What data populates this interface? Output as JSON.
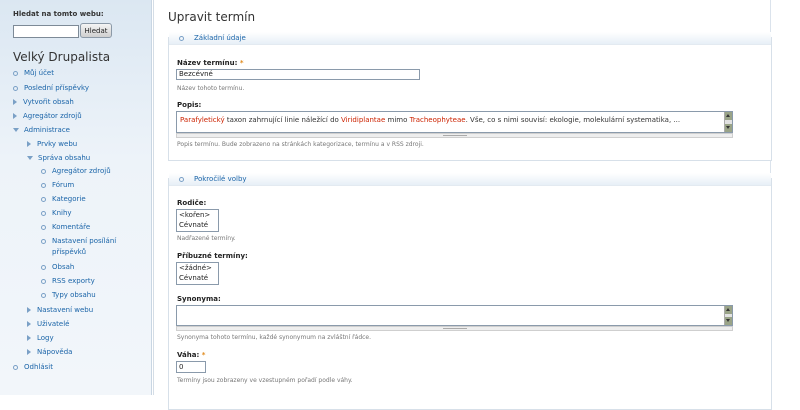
{
  "search": {
    "label": "Hledat na tomto webu:",
    "value": "",
    "button": "Hledat"
  },
  "site_name": "Velký Drupalista",
  "nav": {
    "items": [
      {
        "label": "Můj účet",
        "type": "leaf"
      },
      {
        "label": "Poslední příspěvky",
        "type": "leaf"
      },
      {
        "label": "Vytvořit obsah",
        "type": "collapsed"
      },
      {
        "label": "Agregátor zdrojů",
        "type": "collapsed"
      },
      {
        "label": "Administrace",
        "type": "expanded"
      },
      {
        "label": "Prvky webu",
        "type": "collapsed"
      },
      {
        "label": "Správa obsahu",
        "type": "expanded"
      },
      {
        "label": "Agregátor zdrojů",
        "type": "leaf"
      },
      {
        "label": "Fórum",
        "type": "leaf"
      },
      {
        "label": "Kategorie",
        "type": "leaf"
      },
      {
        "label": "Knihy",
        "type": "leaf"
      },
      {
        "label": "Komentáře",
        "type": "leaf"
      },
      {
        "label": "Nastavení posílání",
        "type": "leaf"
      },
      {
        "label": "příspěvků",
        "type": "cont"
      },
      {
        "label": "Obsah",
        "type": "leaf"
      },
      {
        "label": "RSS exporty",
        "type": "leaf"
      },
      {
        "label": "Typy obsahu",
        "type": "leaf"
      },
      {
        "label": "Nastavení webu",
        "type": "collapsed"
      },
      {
        "label": "Uživatelé",
        "type": "collapsed"
      },
      {
        "label": "Logy",
        "type": "collapsed"
      },
      {
        "label": "Nápověda",
        "type": "collapsed"
      },
      {
        "label": "Odhlásit",
        "type": "leaf"
      }
    ]
  },
  "page_title": "Upravit termín",
  "basic": {
    "legend": "Základní údaje",
    "name_label": "Název termínu:",
    "required_mark": "*",
    "name_value": "Bezcévné",
    "name_desc": "Název tohoto termínu.",
    "desc_label": "Popis:",
    "desc_parts": {
      "p1": "Parafyletický",
      "p2": " taxon zahrnující linie náležící do ",
      "p3": "Viridiplantae",
      "p4": " mimo ",
      "p5": "Tracheophyteae",
      "p6": ". Vše, co s nimi souvisí: ekologie, molekulární systematika, ..."
    },
    "desc_help": "Popis termínu. Bude zobrazeno na stránkách kategorizace, termínu a v RSS zdroji."
  },
  "advanced": {
    "legend": "Pokročilé volby",
    "parents_label": "Rodiče:",
    "parents_options": [
      "<kořen>",
      "Cévnaté"
    ],
    "parents_desc": "Nadřazené termíny.",
    "related_label": "Příbuzné termíny:",
    "related_options": [
      "<žádné>",
      "Cévnaté"
    ],
    "synonyms_label": "Synonyma:",
    "synonyms_desc": "Synonyma tohoto termínu, každé synonymum na zvláštní řádce.",
    "weight_label": "Váha:",
    "weight_value": "0",
    "weight_desc": "Termíny jsou zobrazeny ve vzestupném pořadí podle váhy."
  }
}
